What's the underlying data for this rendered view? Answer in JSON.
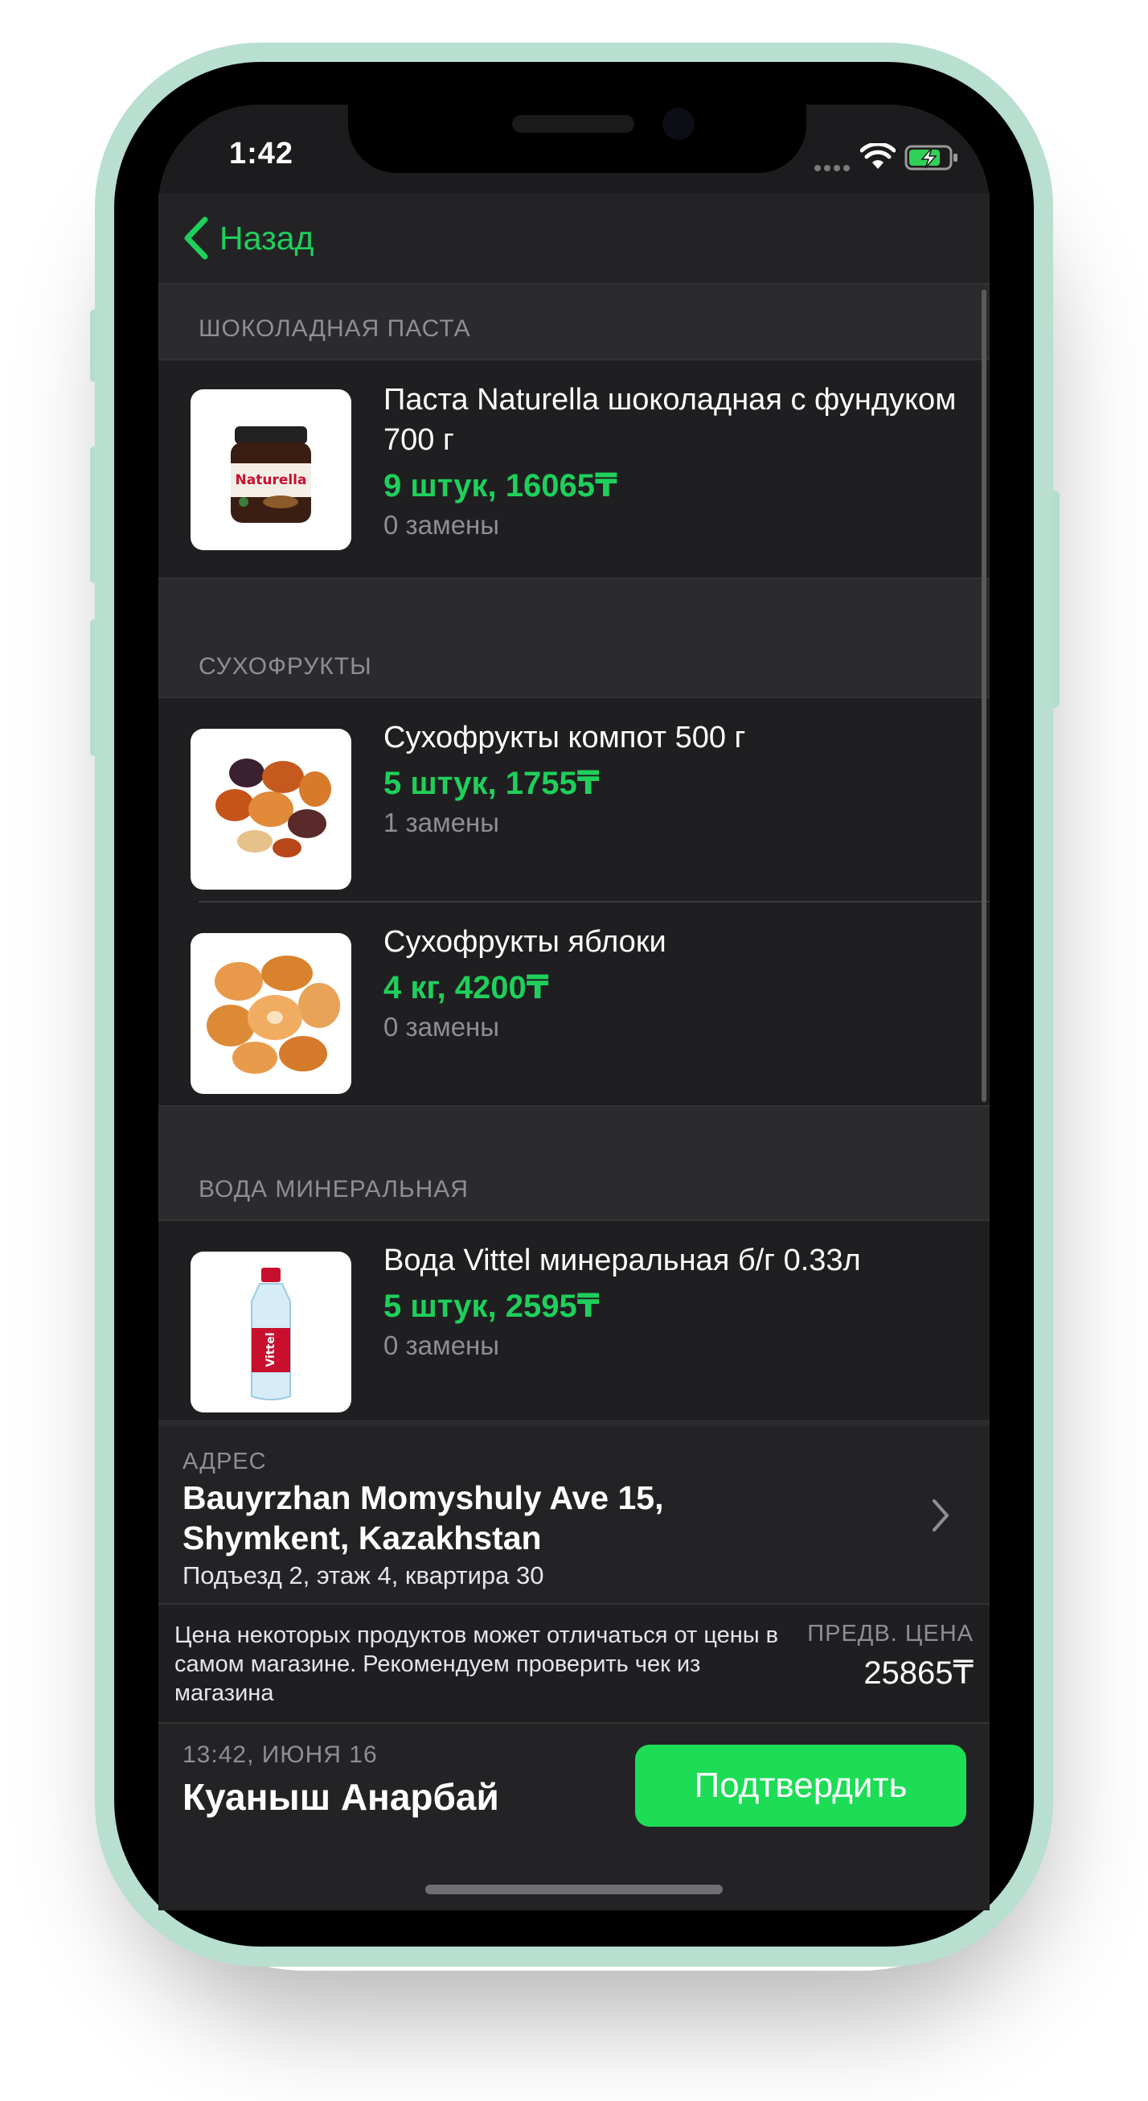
{
  "status_bar": {
    "time": "1:42"
  },
  "nav": {
    "back_label": "Назад"
  },
  "sections": [
    {
      "header": "ШОКОЛАДНАЯ ПАСТА",
      "items": [
        {
          "name": "Паста Naturella шоколадная с фундуком 700 г",
          "quantity": "9 штук, 16065₸",
          "replacements": "0 замены",
          "image_label": "Naturella"
        }
      ]
    },
    {
      "header": "СУХОФРУКТЫ",
      "items": [
        {
          "name": "Сухофрукты компот 500 г",
          "quantity": "5 штук, 1755₸",
          "replacements": "1 замены"
        },
        {
          "name": "Сухофрукты яблоки",
          "quantity": "4 кг, 4200₸",
          "replacements": "0 замены"
        }
      ]
    },
    {
      "header": "ВОДА МИНЕРАЛЬНАЯ",
      "items": [
        {
          "name": "Вода Vittel минеральная б/г 0.33л",
          "quantity": "5 штук, 2595₸",
          "replacements": "0 замены",
          "image_label": "Vittel"
        }
      ]
    }
  ],
  "address": {
    "label": "АДРЕС",
    "line": "Bauyrzhan Momyshuly Ave 15, Shymkent, Kazakhstan",
    "details": "Подъезд 2, этаж 4, квартира 30"
  },
  "price": {
    "disclaimer": "Цена некоторых продуктов может отличаться от цены в самом магазине. Рекомендуем проверить чек из магазина",
    "label": "ПРЕДВ. ЦЕНА",
    "value": "25865₸"
  },
  "footer": {
    "timestamp": "13:42, ИЮНЯ 16",
    "customer": "Куаныш Анарбай",
    "confirm_label": "Подтвердить"
  },
  "colors": {
    "accent": "#1ed05b",
    "button": "#1ddc55",
    "frame": "#b8dfcf",
    "background": "#1c1c1e"
  }
}
